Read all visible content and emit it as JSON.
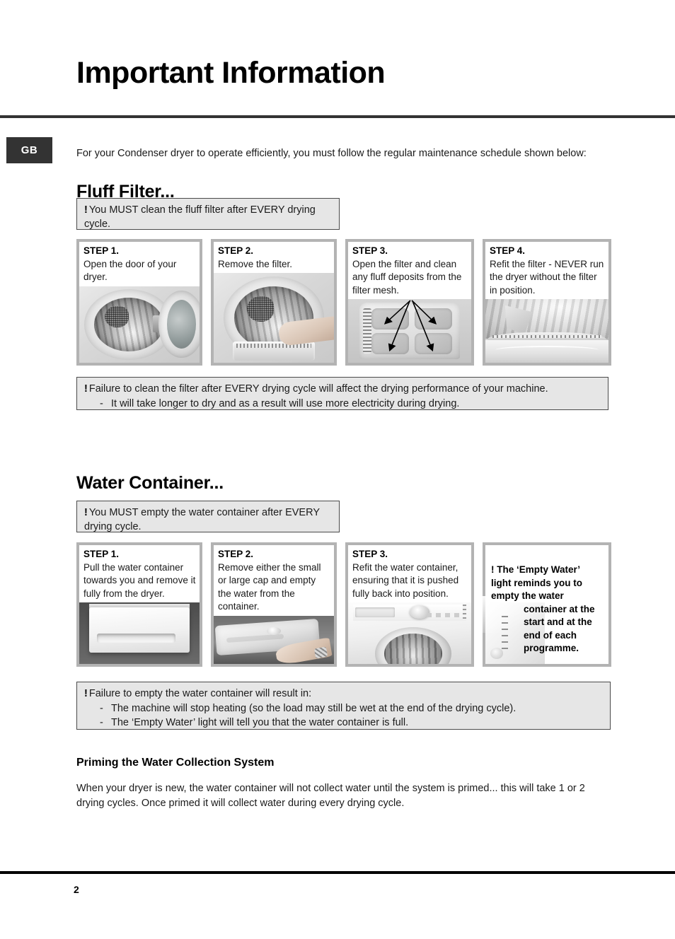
{
  "document": {
    "title": "Important Information",
    "language_badge": "GB",
    "intro": "For your Condenser dryer to operate efficiently, you must follow the regular maintenance schedule shown below:",
    "page_number": "2"
  },
  "fluff_filter": {
    "heading": "Fluff Filter...",
    "notice_top": {
      "bang": "!",
      "text": "You MUST clean the fluff filter after EVERY drying cycle."
    },
    "steps": [
      {
        "label": "STEP 1.",
        "text": "Open the door of your dryer.",
        "photo": "dryer-door-open-photo"
      },
      {
        "label": "STEP 2.",
        "text": "Remove the filter.",
        "photo": "removing-filter-photo"
      },
      {
        "label": "STEP 3.",
        "text": "Open the filter and clean any fluff deposits from the filter mesh.",
        "photo": "open-filter-mesh-photo"
      },
      {
        "label": "STEP 4.",
        "text": "Refit the filter - NEVER run the dryer without the filter in position.",
        "photo": "refit-filter-photo"
      }
    ],
    "notice_bottom": {
      "bang": "!",
      "text": "Failure to clean the filter after EVERY drying cycle will affect the drying performance of your machine.",
      "bullets": [
        {
          "dash": "-",
          "text": "It will take longer to dry and as a result will use more electricity during drying."
        }
      ]
    }
  },
  "water_container": {
    "heading": "Water Container...",
    "notice_top": {
      "bang": "!",
      "text": "You MUST empty the water container after EVERY drying cycle."
    },
    "steps": [
      {
        "label": "STEP 1.",
        "text": "Pull the water container towards you and remove it fully from the dryer.",
        "photo": "water-container-drawer-photo"
      },
      {
        "label": "STEP 2.",
        "text": "Remove either the small or large cap and empty the water from the container.",
        "photo": "emptying-container-photo"
      },
      {
        "label": "STEP 3.",
        "text": "Refit the water container, ensuring that it is pushed fully back into position.",
        "photo": "machine-front-photo"
      }
    ],
    "info_card": {
      "bang": "!",
      "line1": "The ‘Empty Water’",
      "line2": "light reminds you to",
      "line3": "empty the water",
      "line4": "container at the",
      "line5": "start and at the",
      "line6": "end of each",
      "line7": "programme."
    },
    "notice_bottom": {
      "bang": "!",
      "text": "Failure to empty the water container will result in:",
      "bullets": [
        {
          "dash": "-",
          "text": "The machine will stop heating (so the load may still be wet at the end of the drying cycle)."
        },
        {
          "dash": "-",
          "text": "The ‘Empty Water’ light will tell you that the water container is full."
        }
      ]
    }
  },
  "priming": {
    "heading": "Priming the Water Collection System",
    "body": "When your dryer is new, the water container will not collect water until the system is primed... this will take 1 or 2 drying cycles. Once primed it will collect water during every drying cycle."
  },
  "colors": {
    "notice_background": "#e6e6e6",
    "notice_border": "#4a4a4a",
    "badge_background": "#333333",
    "rule": "#333333",
    "card_frame": "#b3b3b3"
  }
}
